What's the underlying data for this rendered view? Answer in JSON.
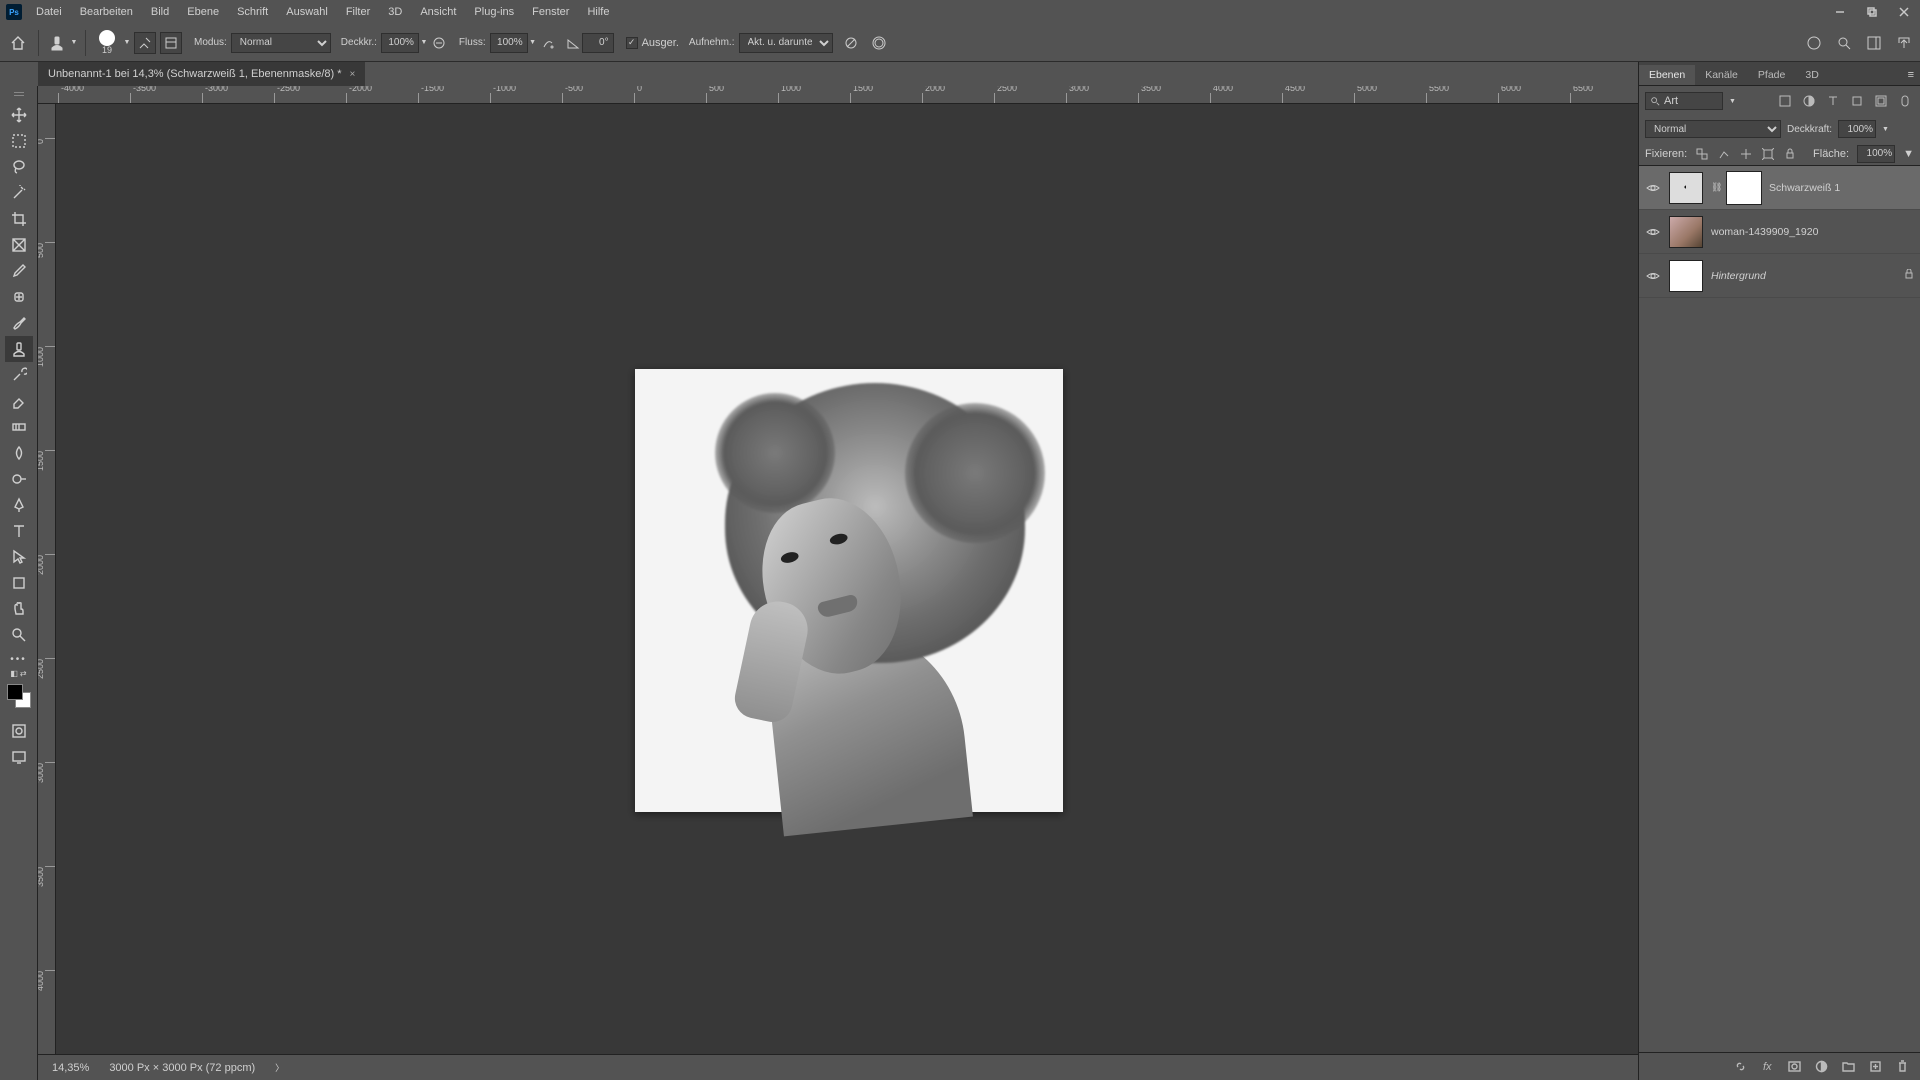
{
  "app_icon": "Ps",
  "menu": [
    "Datei",
    "Bearbeiten",
    "Bild",
    "Ebene",
    "Schrift",
    "Auswahl",
    "Filter",
    "3D",
    "Ansicht",
    "Plug-ins",
    "Fenster",
    "Hilfe"
  ],
  "options": {
    "brush_size": "19",
    "mode_label": "Modus:",
    "mode_value": "Normal",
    "opacity_label": "Deckkr.:",
    "opacity_value": "100%",
    "flow_label": "Fluss:",
    "flow_value": "100%",
    "angle_value": "0°",
    "aligned_label": "Ausger.",
    "sample_label": "Aufnehm.:",
    "sample_value": "Akt. u. darunter"
  },
  "document": {
    "tab_title": "Unbenannt-1 bei 14,3% (Schwarzweiß 1, Ebenenmaske/8) *"
  },
  "ruler_h_marks": [
    "-4000",
    "-3500",
    "-3000",
    "-2500",
    "-2000",
    "-1500",
    "-1000",
    "-500",
    "0",
    "500",
    "1000",
    "1500",
    "2000",
    "2500",
    "3000",
    "3500",
    "4000",
    "4500",
    "5000",
    "5500",
    "6000",
    "6500"
  ],
  "ruler_v_marks": [
    "0",
    "500",
    "1000",
    "1500",
    "2000",
    "2500",
    "3000",
    "3500",
    "4000"
  ],
  "status": {
    "zoom": "14,35%",
    "doc_info": "3000 Px × 3000 Px (72 ppcm)"
  },
  "panels": {
    "tabs": [
      "Ebenen",
      "Kanäle",
      "Pfade",
      "3D"
    ],
    "active_tab": 0,
    "filter_label": "Art",
    "blend_mode": "Normal",
    "opacity_label": "Deckkraft:",
    "opacity_value": "100%",
    "lock_label": "Fixieren:",
    "fill_label": "Fläche:",
    "fill_value": "100%",
    "layers": [
      {
        "name": "Schwarzweiß 1",
        "type": "adjustment",
        "selected": true,
        "visible": true,
        "has_mask": true,
        "locked": false
      },
      {
        "name": "woman-1439909_1920",
        "type": "image",
        "selected": false,
        "visible": true,
        "has_mask": false,
        "locked": false
      },
      {
        "name": "Hintergrund",
        "type": "background",
        "selected": false,
        "visible": true,
        "has_mask": false,
        "locked": true,
        "italic": true
      }
    ]
  }
}
